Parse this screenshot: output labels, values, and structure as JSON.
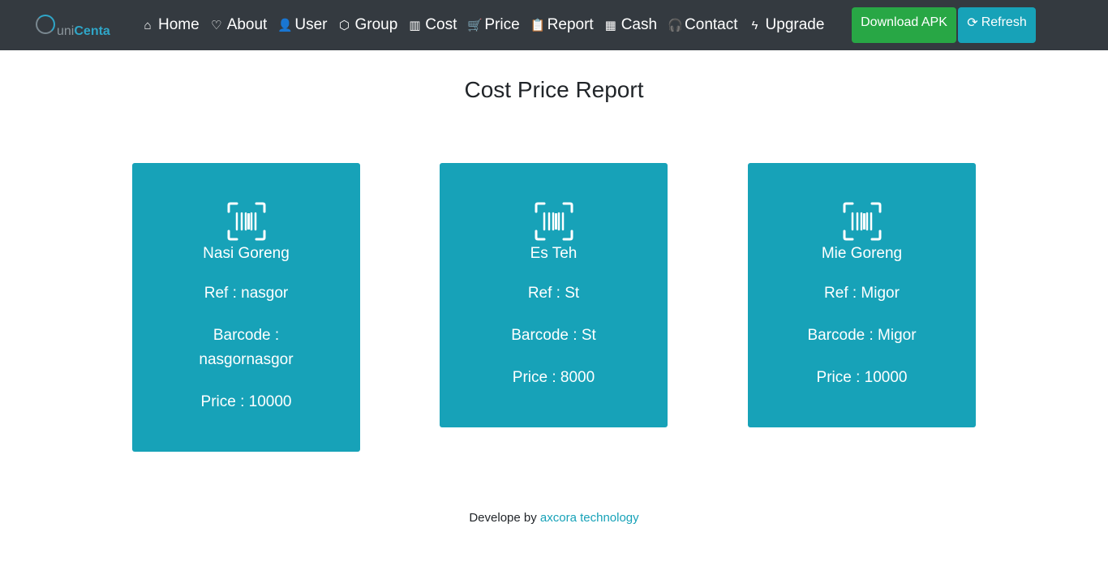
{
  "brand": {
    "prefix": "uni",
    "suffix": "Centa"
  },
  "nav": [
    {
      "icon": "home-icon",
      "glyph": "⌂",
      "label": "Home"
    },
    {
      "icon": "heart-icon",
      "glyph": "♡",
      "label": "About"
    },
    {
      "icon": "user-icon",
      "glyph": "👤",
      "label": "User"
    },
    {
      "icon": "box-icon",
      "glyph": "⬡",
      "label": "Group"
    },
    {
      "icon": "barcode-icon",
      "glyph": "▥",
      "label": "Cost"
    },
    {
      "icon": "cart-icon",
      "glyph": "🛒",
      "label": "Price"
    },
    {
      "icon": "report-icon",
      "glyph": "📋",
      "label": "Report"
    },
    {
      "icon": "calculator-icon",
      "glyph": "▦",
      "label": "Cash"
    },
    {
      "icon": "headset-icon",
      "glyph": "🎧",
      "label": "Contact"
    },
    {
      "icon": "lightning-icon",
      "glyph": "ϟ",
      "label": "Upgrade"
    }
  ],
  "buttons": {
    "download": "Download APK",
    "refresh": "Refresh",
    "refresh_glyph": "⟳"
  },
  "title": "Cost Price Report",
  "cards": [
    {
      "name": "Nasi Goreng",
      "ref": "Ref : nasgor",
      "barcode": "Barcode : nasgornasgor",
      "price": "Price : 10000"
    },
    {
      "name": "Es Teh",
      "ref": "Ref : St",
      "barcode": "Barcode : St",
      "price": "Price : 8000"
    },
    {
      "name": "Mie Goreng",
      "ref": "Ref : Migor",
      "barcode": "Barcode : Migor",
      "price": "Price : 10000"
    }
  ],
  "footer": {
    "text": "Develope by",
    "link": "axcora technology"
  },
  "colors": {
    "navbar": "#343a40",
    "card": "#17a2b8",
    "download": "#28a745",
    "refresh": "#17a2b8"
  }
}
